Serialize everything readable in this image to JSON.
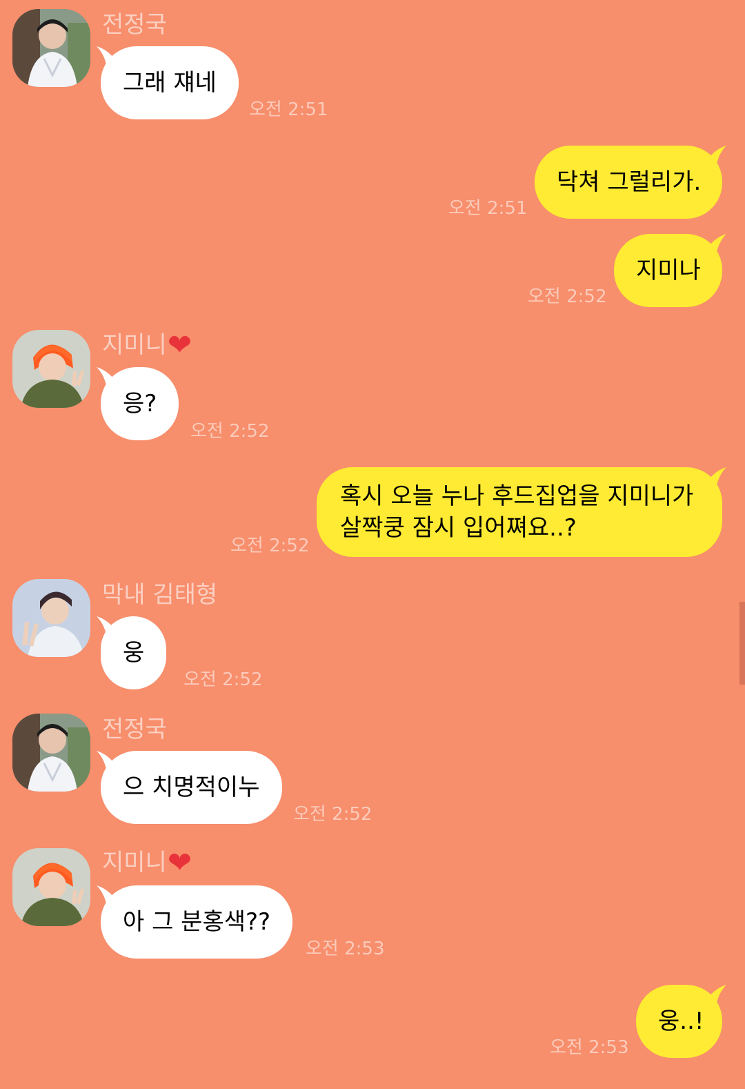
{
  "colors": {
    "background": "#f78e6c",
    "incoming_bubble": "#ffffff",
    "outgoing_bubble": "#ffeb33",
    "sender_name": "#fbd0c2",
    "timestamp": "#fbcbbb",
    "heart": "#e8333a",
    "scrollbar": "#d9755a"
  },
  "messages": [
    {
      "direction": "in",
      "sender": "전정국",
      "avatar": "avatar-jungkook",
      "text": "그래 쟤네",
      "time": "오전 2:51"
    },
    {
      "direction": "out",
      "text": "닥쳐 그럴리가.",
      "time": "오전 2:51"
    },
    {
      "direction": "out",
      "text": "지미나",
      "time": "오전 2:52"
    },
    {
      "direction": "in",
      "sender": "지미니",
      "sender_icon": "heart-icon",
      "avatar": "avatar-jimin",
      "text": "응?",
      "time": "오전 2:52"
    },
    {
      "direction": "out",
      "text": "혹시 오늘 누나 후드집업을 지미니가 살짝쿵 잠시 입어쪄요..?",
      "time": "오전 2:52"
    },
    {
      "direction": "in",
      "sender": "막내 김태형",
      "avatar": "avatar-taehyung",
      "text": "웅",
      "time": "오전 2:52"
    },
    {
      "direction": "in",
      "sender": "전정국",
      "avatar": "avatar-jungkook",
      "text": "으 치명적이누",
      "time": "오전 2:52"
    },
    {
      "direction": "in",
      "sender": "지미니",
      "sender_icon": "heart-icon",
      "avatar": "avatar-jimin",
      "text": "아 그 분홍색??",
      "time": "오전 2:53"
    },
    {
      "direction": "out",
      "text": "웅..!",
      "time": "오전 2:53"
    }
  ]
}
